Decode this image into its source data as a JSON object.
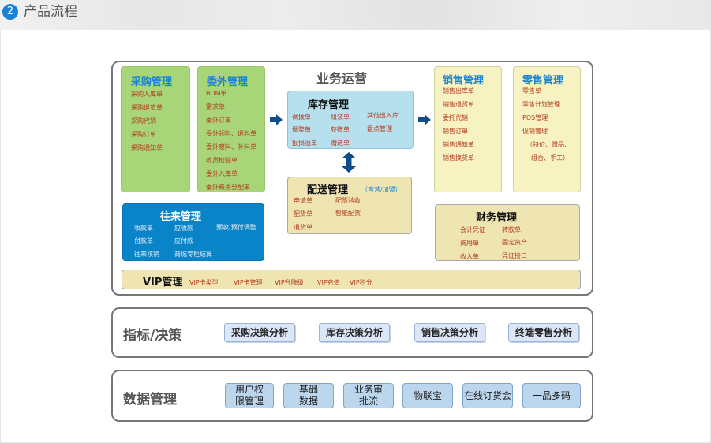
{
  "header": {
    "number": "2",
    "title": "产品流程"
  },
  "operations": {
    "title": "业务运营"
  },
  "purchase": {
    "title": "采购管理",
    "items": [
      "采购入库单",
      "采购退货单",
      "采购代销",
      "采购订单",
      "采购通知单"
    ]
  },
  "outsource": {
    "title": "委外管理",
    "items": [
      "BOM单",
      "需求单",
      "委外订单",
      "委外领料、退料单",
      "委外废料、补料单",
      "收货检验单",
      "委外入库单",
      "委外费用分配单"
    ]
  },
  "inventory": {
    "title": "库存管理",
    "items": [
      "调拨单",
      "组装单",
      "其他出入库",
      "调整单",
      "获赠单",
      "盘点管理",
      "报损溢单",
      "赠送单"
    ]
  },
  "distribution": {
    "title": "配送管理",
    "subtitle": "（直营/加盟）",
    "items": [
      "申请单",
      "配货验收",
      "配货单",
      "智能配货",
      "退货单"
    ]
  },
  "sales": {
    "title": "销售管理",
    "items": [
      "销售出库单",
      "销售退货单",
      "委托代销",
      "销售订单",
      "销售通知单",
      "销售换货单"
    ]
  },
  "retail": {
    "title": "零售管理",
    "items": [
      "零售单",
      "零售计划管理",
      "POS管理",
      "促销管理",
      "（特价、赠品、",
      "组合、手工）"
    ]
  },
  "accounts": {
    "title": "往来管理",
    "items": [
      "收款单",
      "应收款",
      "预收/预付调整",
      "付款单",
      "应付款",
      "往来核销",
      "商城专柜结算"
    ]
  },
  "finance": {
    "title": "财务管理",
    "items": [
      "会计凭证",
      "转款单",
      "费用单",
      "固定资产",
      "收入单",
      "凭证接口"
    ]
  },
  "vip": {
    "title": "VIP管理",
    "items": [
      "VIP卡类型",
      "VIP卡管理",
      "VIP升降级",
      "VIP充值",
      "VIP积分"
    ]
  },
  "indicators": {
    "title": "指标/决策",
    "buttons": [
      "采购决策分析",
      "库存决策分析",
      "销售决策分析",
      "终端零售分析"
    ]
  },
  "data_mgmt": {
    "title": "数据管理",
    "buttons": [
      [
        "用户权",
        "限管理"
      ],
      [
        "基础",
        "数据"
      ],
      [
        "业务审",
        "批流"
      ],
      [
        "物联宝"
      ],
      [
        "在线订货会"
      ],
      [
        "一品多码"
      ]
    ]
  },
  "colors": {
    "accent_blue": "#1a84d2",
    "item_red": "#b23c1e",
    "green_box": "#a8d578",
    "yellow_box": "#efe5b2",
    "cyan_box": "#b7e0ee",
    "blue_box": "#0a84c9",
    "button_blue": "#dbe7f7"
  }
}
